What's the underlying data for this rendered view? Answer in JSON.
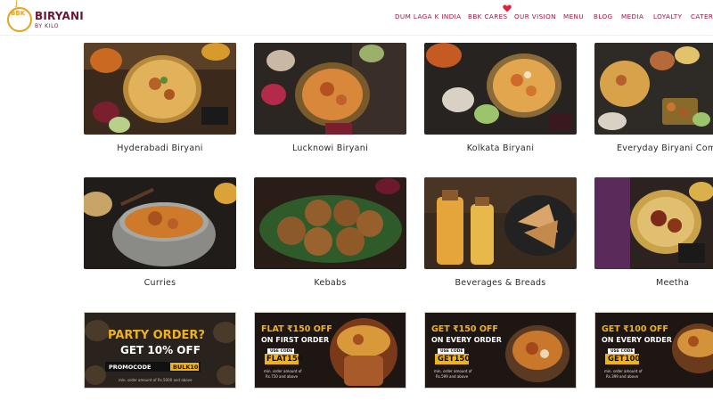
{
  "brand": {
    "badge": "BBK",
    "name": "BIRYANI",
    "tagline": "BY KILO",
    "colors": {
      "maroon": "#6b1530",
      "gold": "#e7a21f",
      "nav": "#a3123c"
    }
  },
  "nav": {
    "items": [
      "DUM LAGA K INDIA",
      "BBK CARES",
      "OUR VISION",
      "MENU",
      "BLOG",
      "MEDIA",
      "LOYALTY",
      "CATERI"
    ],
    "heart_icon": "heart-icon"
  },
  "menu": {
    "categories": [
      {
        "label": "Hyderabadi Biryani"
      },
      {
        "label": "Lucknowi Biryani"
      },
      {
        "label": "Kolkata Biryani"
      },
      {
        "label": "Everyday Biryani Comb"
      },
      {
        "label": "Curries"
      },
      {
        "label": "Kebabs"
      },
      {
        "label": "Beverages & Breads"
      },
      {
        "label": "Meetha"
      }
    ]
  },
  "offers": [
    {
      "line1": "PARTY ORDER?",
      "line2": "GET 10% OFF",
      "code_label": "PROMOCODE",
      "code": "BULK10",
      "fine": "min. order amount of Rs.5000 and above"
    },
    {
      "line1": "FLAT ₹150 OFF",
      "line2": "ON FIRST ORDER",
      "code_label": "USE CODE",
      "code": "FLAT150",
      "fine1": "min. order amount of",
      "fine2": "Rs.750 and above"
    },
    {
      "line1": "GET ₹150 OFF",
      "line2": "ON EVERY ORDER",
      "code_label": "USE CODE",
      "code": "GET150",
      "fine1": "min. order amount of",
      "fine2": "Rs.599 and above"
    },
    {
      "line1": "GET ₹100 OFF",
      "line2": "ON EVERY ORDER",
      "code_label": "USE CODE",
      "code": "GET100",
      "fine1": "min. order amount of",
      "fine2": "Rs.399 and above"
    }
  ]
}
